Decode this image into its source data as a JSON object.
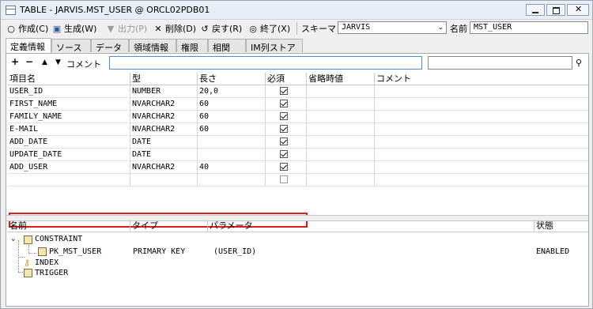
{
  "window": {
    "title": "TABLE - JARVIS.MST_USER @ ORCL02PDB01"
  },
  "toolbar": {
    "create": "作成(C)",
    "generate": "生成(W)",
    "output": "出力(P)",
    "delete": "削除(D)",
    "back": "戻す(R)",
    "exit": "終了(X)",
    "schema_label": "スキーマ",
    "schema_value": "JARVIS",
    "name_label": "名前",
    "name_value": "MST_USER"
  },
  "tabs": [
    "定義情報",
    "ソース",
    "データ",
    "領域情報",
    "権限",
    "相関",
    "IM列ストア"
  ],
  "controls": {
    "comment_label": "コメント"
  },
  "columns_table": {
    "headers": [
      "項目名",
      "型",
      "長さ",
      "必須",
      "省略時値",
      "コメント"
    ],
    "rows": [
      {
        "name": "USER_ID",
        "type": "NUMBER",
        "length": "20,0",
        "required": true
      },
      {
        "name": "FIRST_NAME",
        "type": "NVARCHAR2",
        "length": "60",
        "required": true
      },
      {
        "name": "FAMILY_NAME",
        "type": "NVARCHAR2",
        "length": "60",
        "required": true
      },
      {
        "name": "E-MAIL",
        "type": "NVARCHAR2",
        "length": "60",
        "required": true
      },
      {
        "name": "ADD_DATE",
        "type": "DATE",
        "length": "",
        "required": true
      },
      {
        "name": "UPDATE_DATE",
        "type": "DATE",
        "length": "",
        "required": true
      },
      {
        "name": "ADD_USER",
        "type": "NVARCHAR2",
        "length": "40",
        "required": true
      },
      {
        "name": "",
        "type": "",
        "length": "",
        "required": false
      }
    ],
    "highlight_color": "#e0191b"
  },
  "constraints": {
    "headers": [
      "名前",
      "タイプ",
      "パラメータ",
      "状態"
    ],
    "root": "CONSTRAINT",
    "item": {
      "name": "PK_MST_USER",
      "type": "PRIMARY KEY",
      "params": "(USER_ID)",
      "status": "ENABLED"
    },
    "index": "INDEX",
    "trigger": "TRIGGER"
  },
  "icons": {
    "create": "circle-icon",
    "generate": "generate-icon",
    "output": "triangle-down-icon",
    "delete": "x-icon",
    "back": "undo-icon",
    "exit": "exit-icon",
    "add": "plus-icon",
    "remove": "minus-icon",
    "up": "up-arrow-icon",
    "down": "down-arrow-icon",
    "search": "binoculars-icon"
  }
}
